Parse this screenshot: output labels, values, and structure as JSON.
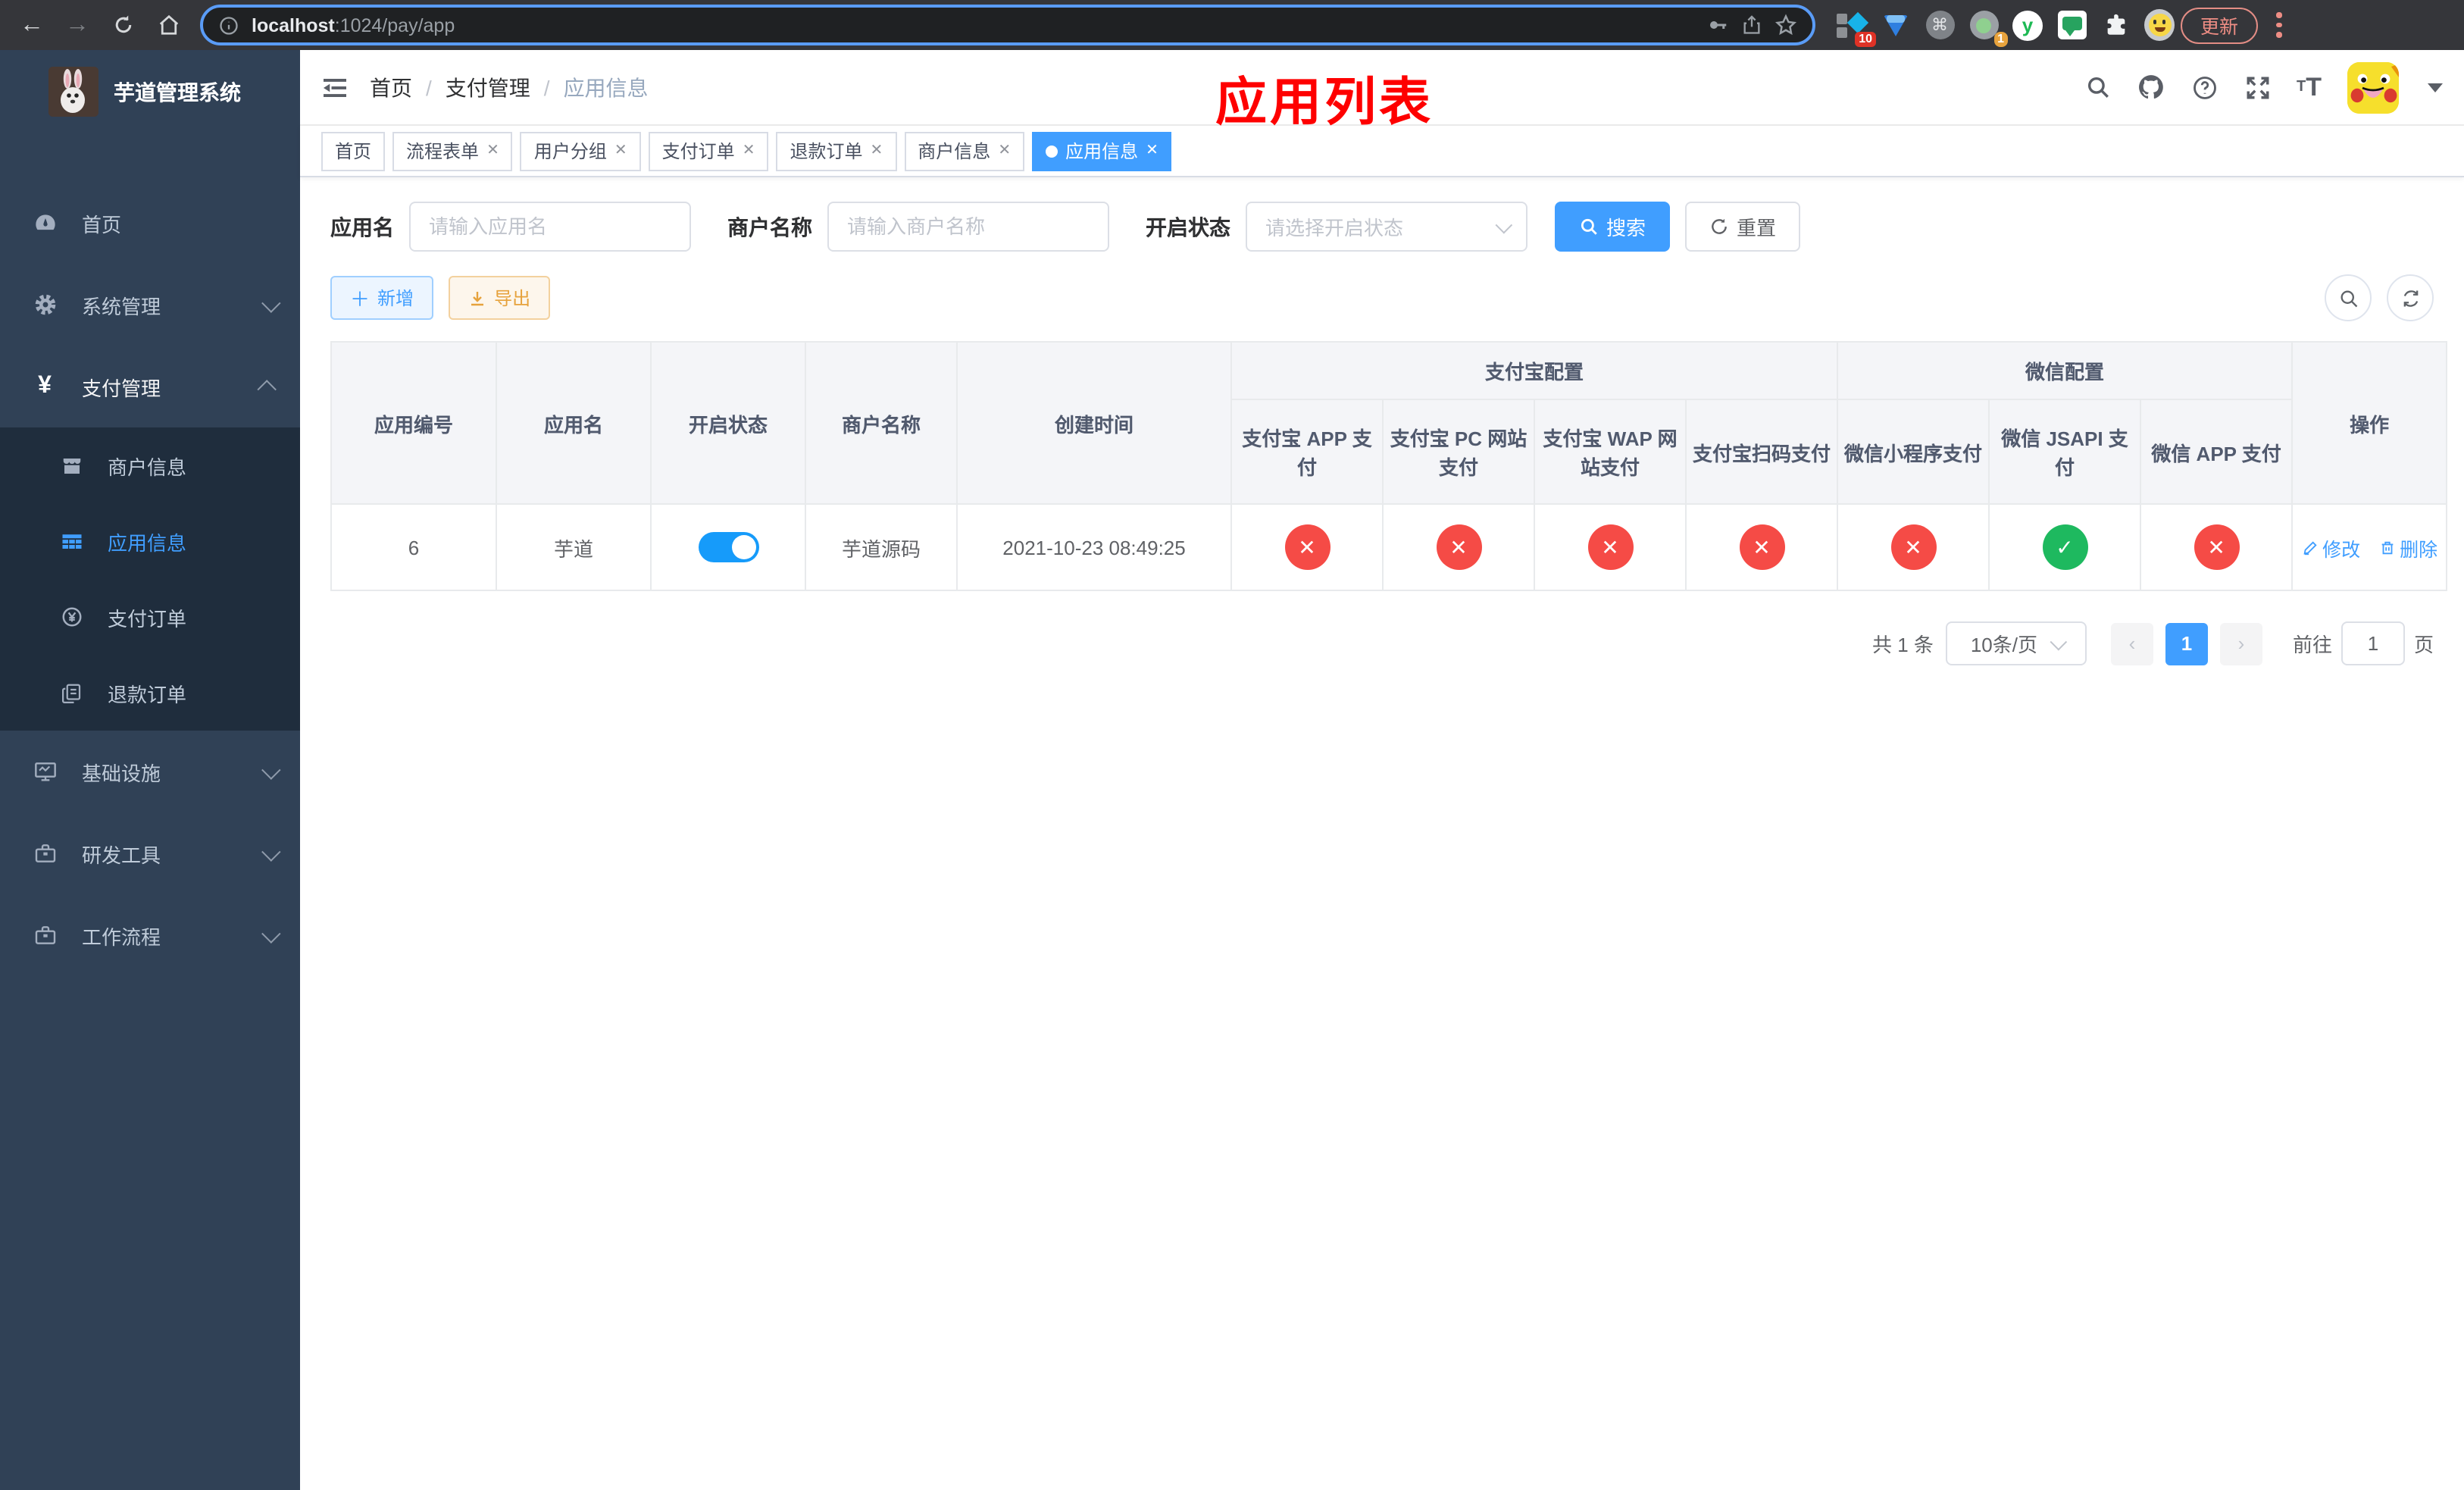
{
  "browser": {
    "url_host": "localhost",
    "url_path": ":1024/pay/app",
    "update_label": "更新",
    "ext_badge_a": "10",
    "ext_badge_b": "1",
    "ext_command": "⌘",
    "ext_y": "y"
  },
  "sidebar": {
    "title": "芋道管理系统",
    "menu": [
      {
        "label": "首页"
      },
      {
        "label": "系统管理"
      },
      {
        "label": "支付管理"
      },
      {
        "label": "基础设施"
      },
      {
        "label": "研发工具"
      },
      {
        "label": "工作流程"
      }
    ],
    "submenu": [
      {
        "label": "商户信息"
      },
      {
        "label": "应用信息"
      },
      {
        "label": "支付订单"
      },
      {
        "label": "退款订单"
      }
    ]
  },
  "header": {
    "breadcrumb": [
      "首页",
      "支付管理",
      "应用信息"
    ],
    "overlay_title": "应用列表"
  },
  "tags": [
    {
      "label": "首页"
    },
    {
      "label": "流程表单"
    },
    {
      "label": "用户分组"
    },
    {
      "label": "支付订单"
    },
    {
      "label": "退款订单"
    },
    {
      "label": "商户信息"
    },
    {
      "label": "应用信息"
    }
  ],
  "filters": {
    "app_name_label": "应用名",
    "app_name_placeholder": "请输入应用名",
    "merchant_label": "商户名称",
    "merchant_placeholder": "请输入商户名称",
    "status_label": "开启状态",
    "status_placeholder": "请选择开启状态",
    "search_label": "搜索",
    "reset_label": "重置"
  },
  "toolbar": {
    "add_label": "新增",
    "export_label": "导出"
  },
  "table": {
    "columns": [
      "应用编号",
      "应用名",
      "开启状态",
      "商户名称",
      "创建时间"
    ],
    "alipay_group": "支付宝配置",
    "wechat_group": "微信配置",
    "pay_columns": [
      "支付宝 APP 支付",
      "支付宝 PC 网站支付",
      "支付宝 WAP 网站支付",
      "支付宝扫码支付",
      "微信小程序支付",
      "微信 JSAPI 支付",
      "微信 APP 支付"
    ],
    "ops_column": "操作",
    "row": {
      "id": "6",
      "name": "芋道",
      "enabled": true,
      "merchant": "芋道源码",
      "created": "2021-10-23 08:49:25",
      "statuses": [
        "no",
        "no",
        "no",
        "no",
        "no",
        "ok",
        "no"
      ],
      "edit_label": "修改",
      "delete_label": "删除"
    }
  },
  "pagination": {
    "total": "共 1 条",
    "page_size": "10条/页",
    "page": "1",
    "goto_label": "前往",
    "goto_value": "1",
    "goto_suffix": "页"
  },
  "colors": {
    "accent": "#409eff",
    "sidebar_bg": "#304156",
    "submenu_bg": "#1f2d3d",
    "success": "#1eb95f",
    "danger": "#f54b46",
    "annotation": "#fe0000"
  }
}
